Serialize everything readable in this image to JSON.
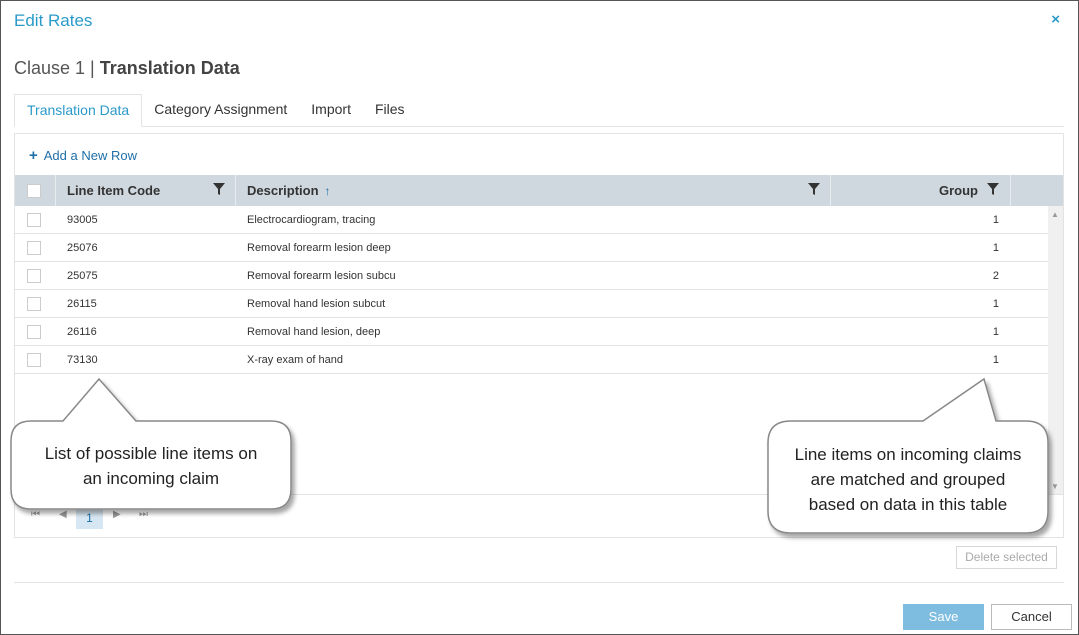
{
  "dialog": {
    "title": "Edit Rates",
    "close_glyph": "×"
  },
  "heading": {
    "prefix": "Clause 1 | ",
    "bold": "Translation Data"
  },
  "tabs": [
    {
      "label": "Translation Data",
      "active": true
    },
    {
      "label": "Category Assignment",
      "active": false
    },
    {
      "label": "Import",
      "active": false
    },
    {
      "label": "Files",
      "active": false
    }
  ],
  "toolbar": {
    "add_row_label": "Add a New Row",
    "add_icon": "plus-icon"
  },
  "grid": {
    "columns": {
      "code": "Line Item Code",
      "description": "Description",
      "group": "Group"
    },
    "sort_glyph": "↑",
    "rows": [
      {
        "code": "93005",
        "description": "Electrocardiogram, tracing",
        "group": "1"
      },
      {
        "code": "25076",
        "description": "Removal forearm lesion deep",
        "group": "1"
      },
      {
        "code": "25075",
        "description": "Removal forearm lesion subcu",
        "group": "2"
      },
      {
        "code": "26115",
        "description": "Removal hand lesion subcut",
        "group": "1"
      },
      {
        "code": "26116",
        "description": "Removal hand lesion, deep",
        "group": "1"
      },
      {
        "code": "73130",
        "description": "X-ray exam of hand",
        "group": "1"
      }
    ]
  },
  "pager": {
    "first": "⏮",
    "prev": "◀",
    "current_page": "1",
    "next": "▶",
    "last": "⏭"
  },
  "actions": {
    "delete_selected": "Delete selected",
    "save": "Save",
    "cancel": "Cancel"
  },
  "callouts": {
    "left_line1": "List of possible line items on",
    "left_line2": "an incoming claim",
    "right_line1": "Line items on incoming claims",
    "right_line2": "are matched and grouped",
    "right_line3": "based on data in this table"
  },
  "colors": {
    "accent": "#2a9ac9",
    "header_bg": "#cfd8de",
    "save_bg": "#7fbde0"
  }
}
